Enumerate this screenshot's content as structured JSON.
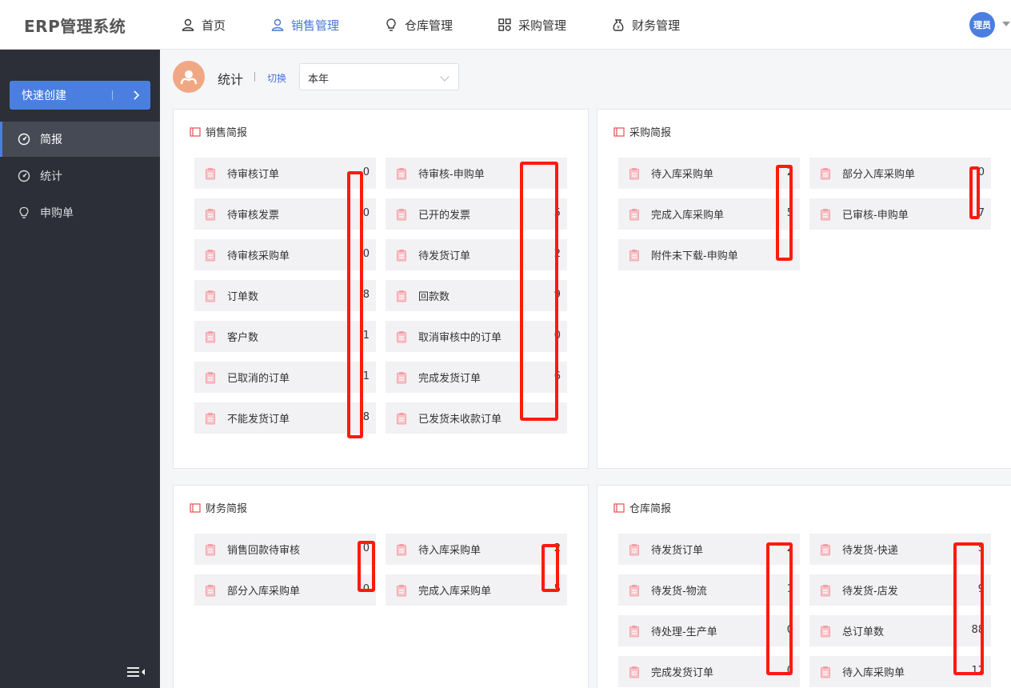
{
  "app": {
    "title": "ERP管理系统"
  },
  "nav": [
    {
      "label": "首页",
      "icon": "user-icon"
    },
    {
      "label": "销售管理",
      "icon": "user-icon",
      "active": true
    },
    {
      "label": "仓库管理",
      "icon": "bulb-icon"
    },
    {
      "label": "采购管理",
      "icon": "grid-icon"
    },
    {
      "label": "财务管理",
      "icon": "money-bag-icon"
    }
  ],
  "user": {
    "avatar_text": "理员"
  },
  "sidebar": {
    "quick_create": "快速创建",
    "items": [
      {
        "label": "简报",
        "icon": "dashboard-icon",
        "active": true
      },
      {
        "label": "统计",
        "icon": "dashboard-icon"
      },
      {
        "label": "申购单",
        "icon": "bulb-icon"
      }
    ]
  },
  "stats_header": {
    "title": "统计",
    "switch_label": "切换",
    "period_selected": "本年"
  },
  "panels": {
    "sales": {
      "title": "销售简报",
      "items": [
        {
          "label": "待审核订单",
          "value": "0"
        },
        {
          "label": "待审核-申购单",
          "value": ""
        },
        {
          "label": "待审核发票",
          "value": "0"
        },
        {
          "label": "已开的发票",
          "value": "5"
        },
        {
          "label": "待审核采购单",
          "value": "0"
        },
        {
          "label": "待发货订单",
          "value": "2"
        },
        {
          "label": "订单数",
          "value": "8"
        },
        {
          "label": "回款数",
          "value": "9"
        },
        {
          "label": "客户数",
          "value": "1"
        },
        {
          "label": "取消审核中的订单",
          "value": "0"
        },
        {
          "label": "已取消的订单",
          "value": "1"
        },
        {
          "label": "完成发货订单",
          "value": "6"
        },
        {
          "label": "不能发货订单",
          "value": "8"
        },
        {
          "label": "已发货未收款订单",
          "value": ""
        }
      ]
    },
    "purchase": {
      "title": "采购简报",
      "items": [
        {
          "label": "待入库采购单",
          "value": "2"
        },
        {
          "label": "部分入库采购单",
          "value": "0"
        },
        {
          "label": "完成入库采购单",
          "value": "5"
        },
        {
          "label": "已审核-申购单",
          "value": "7"
        },
        {
          "label": "附件未下载-申购单",
          "value": ""
        }
      ]
    },
    "finance": {
      "title": "财务简报",
      "items": [
        {
          "label": "销售回款待审核",
          "value": "0"
        },
        {
          "label": "待入库采购单",
          "value": "2"
        },
        {
          "label": "部分入库采购单",
          "value": "0"
        },
        {
          "label": "完成入库采购单",
          "value": "5"
        }
      ]
    },
    "warehouse": {
      "title": "仓库简报",
      "items": [
        {
          "label": "待发货订单",
          "value": "2"
        },
        {
          "label": "待发货-快递",
          "value": "5"
        },
        {
          "label": "待发货-物流",
          "value": "1"
        },
        {
          "label": "待发货-店发",
          "value": "9"
        },
        {
          "label": "待处理-生产单",
          "value": "0"
        },
        {
          "label": "总订单数",
          "value": "88"
        },
        {
          "label": "完成发货订单",
          "value": "0"
        },
        {
          "label": "待入库采购单",
          "value": "12"
        }
      ]
    }
  },
  "colors": {
    "accent": "#4a7fe0",
    "sidebar_bg": "#2c2f38",
    "redaction": "#ff1a0e",
    "icon_pink": "#f2a0a8"
  }
}
